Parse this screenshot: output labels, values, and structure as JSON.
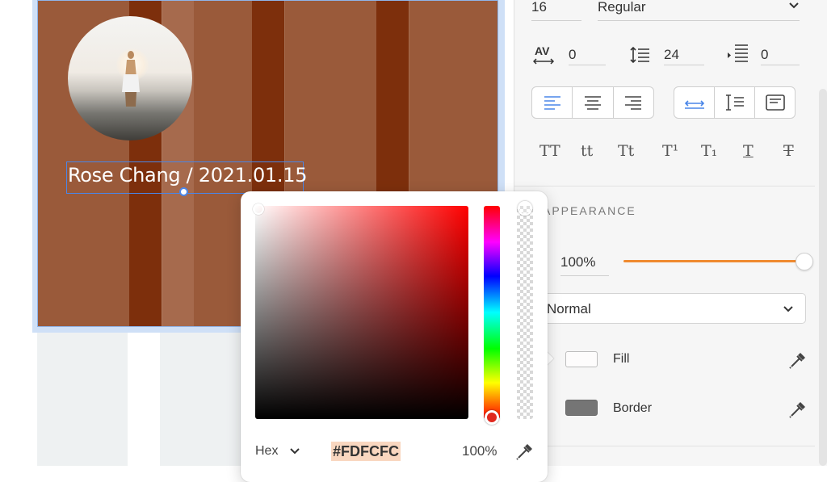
{
  "canvas": {
    "caption": "Rose Chang / 2021.01.15",
    "colors": {
      "artboard_bg": "#9a5a3a",
      "grid_dark": "#7d2f0c",
      "selection": "#4a86e8"
    }
  },
  "typography": {
    "font_size": "16",
    "font_weight": "Regular",
    "letter_spacing": "0",
    "line_height": "24",
    "paragraph_spacing": "0",
    "text_transform_options": [
      "TT",
      "tt",
      "Tt",
      "T¹",
      "T₁",
      "T",
      "T"
    ]
  },
  "appearance": {
    "section_title": "APPEARANCE",
    "opacity": "100%",
    "opacity_level": 1.0,
    "accent_color": "#ef8a2f",
    "blend_mode": "Normal",
    "fill_label": "Fill",
    "fill_color": "#FDFCFC",
    "border_label": "Border",
    "border_color": "#757575"
  },
  "color_picker": {
    "format": "Hex",
    "hex_value": "#FDFCFC",
    "alpha": "100%"
  }
}
